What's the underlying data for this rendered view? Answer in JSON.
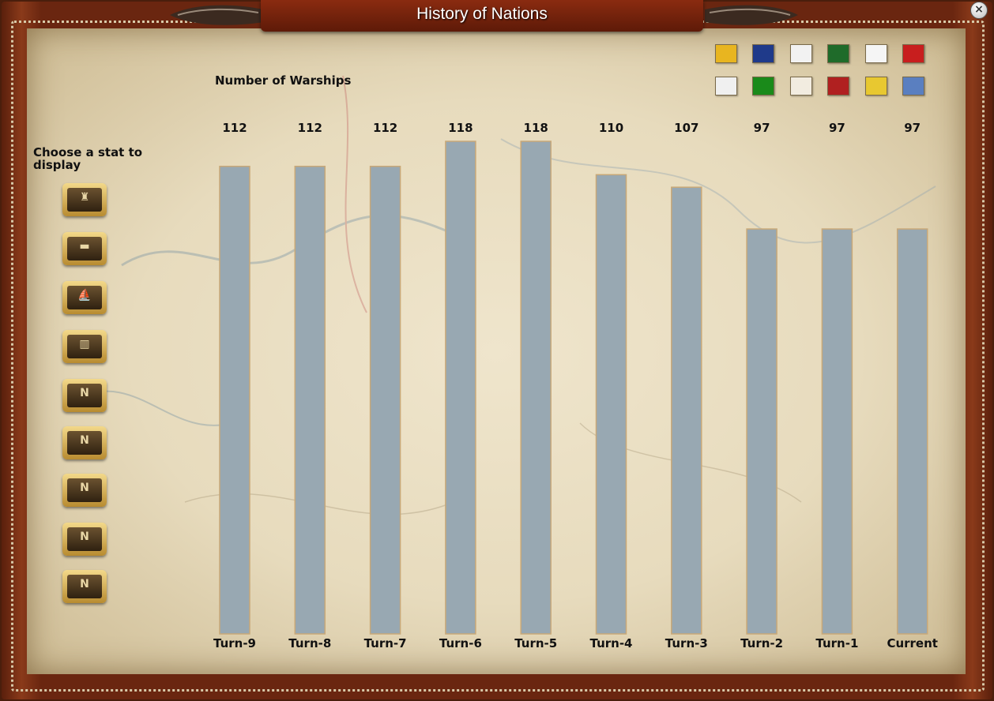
{
  "window": {
    "title": "History of Nations",
    "close_label": "×"
  },
  "sidebar": {
    "heading": "Choose a stat to display",
    "buttons": [
      {
        "name": "stat-lighthouse",
        "glyph": "♜"
      },
      {
        "name": "stat-cannon",
        "glyph": "▬"
      },
      {
        "name": "stat-ship",
        "glyph": "⛵"
      },
      {
        "name": "stat-fortress",
        "glyph": "▥"
      },
      {
        "name": "stat-n-soldier",
        "glyph": "N"
      },
      {
        "name": "stat-n-cannon",
        "glyph": "N"
      },
      {
        "name": "stat-n-ship",
        "glyph": "N"
      },
      {
        "name": "stat-n-cavalry",
        "glyph": "N"
      },
      {
        "name": "stat-n-flag",
        "glyph": "N"
      }
    ]
  },
  "flags": [
    {
      "name": "russia-flag-icon",
      "color": "#e8b520"
    },
    {
      "name": "britain-flag-icon",
      "color": "#1f3a8a"
    },
    {
      "name": "france-flag-icon",
      "color": "#f2f2f2"
    },
    {
      "name": "portugal-flag-icon",
      "color": "#1f6b2a"
    },
    {
      "name": "spain-flag-icon",
      "color": "#f5f5f5"
    },
    {
      "name": "ottoman-flag-icon",
      "color": "#c81e1e"
    },
    {
      "name": "prussia-flag-icon",
      "color": "#f0f0f0"
    },
    {
      "name": "egypt-flag-icon",
      "color": "#1a8a1a"
    },
    {
      "name": "austria-flag-icon",
      "color": "#f2ece0"
    },
    {
      "name": "sweden-flag-icon",
      "color": "#b02020"
    },
    {
      "name": "papal-flag-icon",
      "color": "#e8c830"
    },
    {
      "name": "bavaria-flag-icon",
      "color": "#5a7fc0"
    }
  ],
  "chart_data": {
    "type": "bar",
    "title": "Number of Warships",
    "categories": [
      "Turn-9",
      "Turn-8",
      "Turn-7",
      "Turn-6",
      "Turn-5",
      "Turn-4",
      "Turn-3",
      "Turn-2",
      "Turn-1",
      "Current"
    ],
    "values": [
      112,
      112,
      112,
      118,
      118,
      110,
      107,
      97,
      97,
      97
    ],
    "bar_color": "#98a8b2",
    "bar_border": "#c8a878"
  }
}
